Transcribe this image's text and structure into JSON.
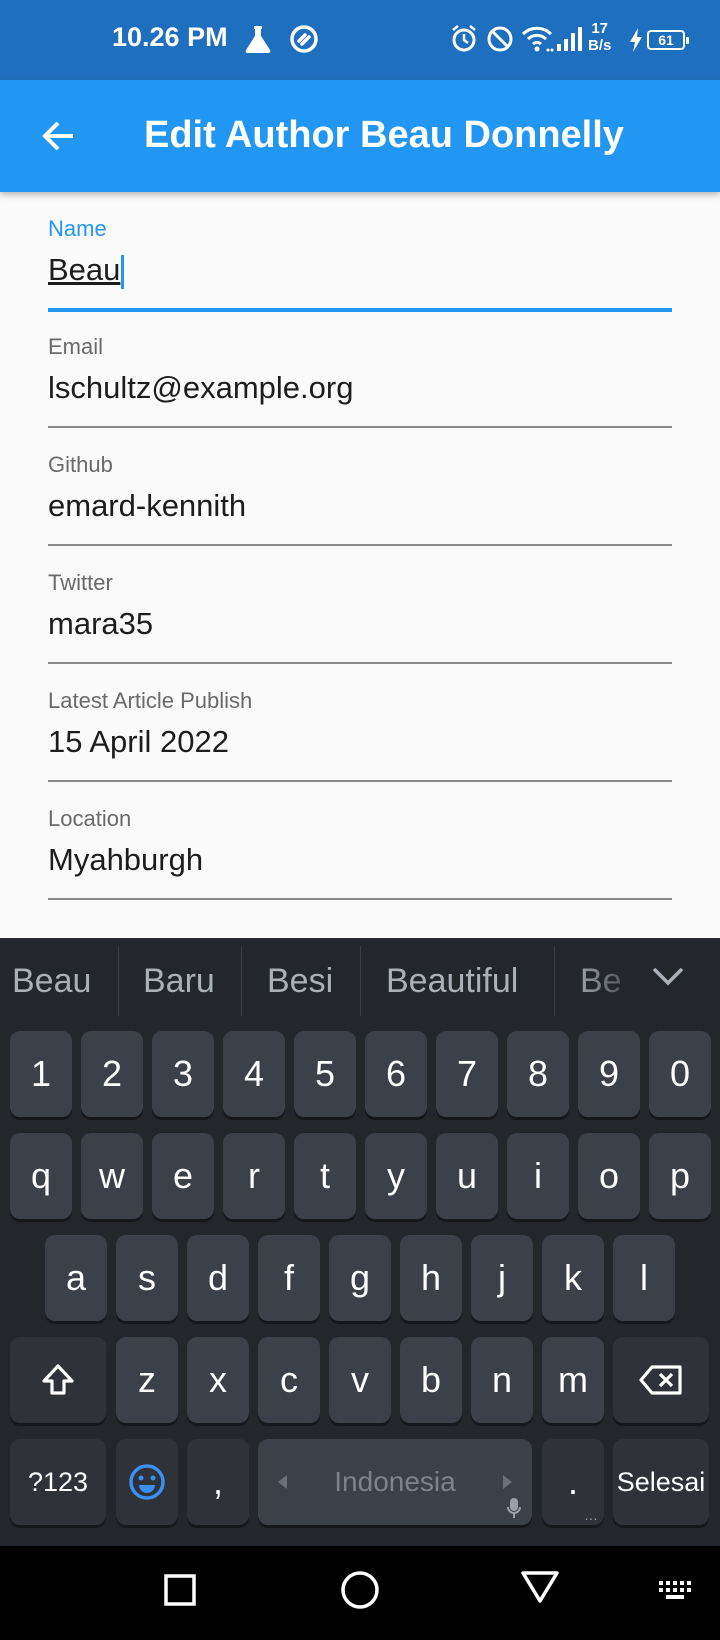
{
  "status_bar": {
    "time": "10.26 PM",
    "net_rate_value": "17",
    "net_rate_unit": "B/s",
    "battery": "61",
    "icons": [
      "lab-flask-icon",
      "sync-icon",
      "alarm-icon",
      "dnd-icon",
      "wifi-icon",
      "signal-icon",
      "charging-icon",
      "battery-icon"
    ]
  },
  "app_bar": {
    "title": "Edit Author Beau Donnelly",
    "back_icon": "arrow-back-icon",
    "color": "#2196f3"
  },
  "form": {
    "fields": [
      {
        "label": "Name",
        "value": "Beau",
        "focused": true
      },
      {
        "label": "Email",
        "value": "lschultz@example.org"
      },
      {
        "label": "Github",
        "value": "emard-kennith"
      },
      {
        "label": "Twitter",
        "value": "mara35"
      },
      {
        "label": "Latest Article Publish",
        "value": "15 April 2022"
      },
      {
        "label": "Location",
        "value": "Myahburgh"
      }
    ]
  },
  "keyboard": {
    "suggestions": [
      "Beau",
      "Baru",
      "Besi",
      "Beautiful",
      "Be"
    ],
    "rows": [
      [
        "1",
        "2",
        "3",
        "4",
        "5",
        "6",
        "7",
        "8",
        "9",
        "0"
      ],
      [
        "q",
        "w",
        "e",
        "r",
        "t",
        "y",
        "u",
        "i",
        "o",
        "p"
      ],
      [
        "a",
        "s",
        "d",
        "f",
        "g",
        "h",
        "j",
        "k",
        "l"
      ],
      [
        "z",
        "x",
        "c",
        "v",
        "b",
        "n",
        "m"
      ]
    ],
    "symbols_key": "?123",
    "comma_key": ",",
    "space_label": "Indonesia",
    "period_key": ".",
    "action_key": "Selesai"
  },
  "nav_bar": {
    "icons": [
      "recents-square-icon",
      "home-circle-icon",
      "back-triangle-icon",
      "keyboard-switch-icon"
    ]
  }
}
